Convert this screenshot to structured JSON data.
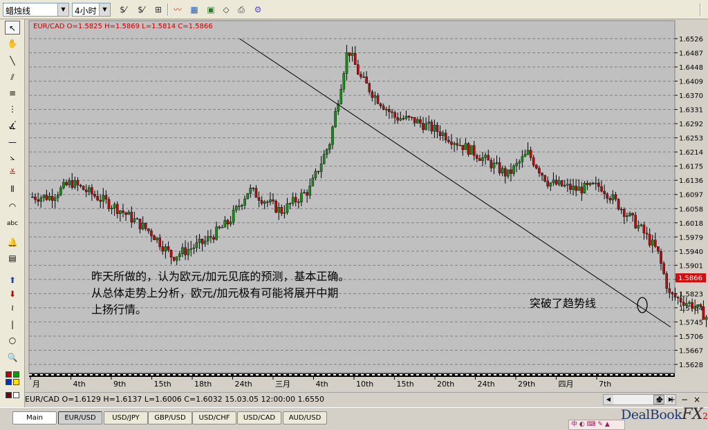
{
  "toolbar": {
    "chart_type": "蜡烛线",
    "timeframe": "4小时"
  },
  "chart_header": "EUR/CAD O=1.5825 H=1.5869 L=1.5814 C=1.5866",
  "chart_data": {
    "type": "candlestick",
    "symbol": "EUR/CAD",
    "y_ticks": [
      "1.6526",
      "1.6487",
      "1.6448",
      "1.6409",
      "1.6370",
      "1.6331",
      "1.6292",
      "1.6253",
      "1.6214",
      "1.6175",
      "1.6136",
      "1.6097",
      "1.6058",
      "1.6018",
      "1.5979",
      "1.5940",
      "1.5901",
      "1.5862",
      "1.5823",
      "1.5784",
      "1.5745",
      "1.5706",
      "1.5667",
      "1.5628"
    ],
    "ylim": [
      1.5628,
      1.6526
    ],
    "x_ticks": [
      "月",
      "4th",
      "9th",
      "15th",
      "18th",
      "24th",
      "三月",
      "4th",
      "10th",
      "15th",
      "20th",
      "24th",
      "29th",
      "四月",
      "7th"
    ],
    "last_price": "1.5866",
    "annotations": [
      "昨天所做的，认为欧元/加元见底的预测，基本正确。",
      "从总体走势上分析，欧元/加元极有可能将展开中期",
      "上扬行情。",
      "突破了趋势线"
    ],
    "trendline": {
      "start": {
        "x": "24th",
        "y": 1.6526
      },
      "end": {
        "x": "7th",
        "y": 1.575
      }
    },
    "anchors": [
      {
        "x": 0.5,
        "y": 1.609
      },
      {
        "x": 1,
        "y": 1.613
      },
      {
        "x": 2.2,
        "y": 1.6055
      },
      {
        "x": 3,
        "y": 1.599
      },
      {
        "x": 3.5,
        "y": 1.5925
      },
      {
        "x": 4.3,
        "y": 1.5965
      },
      {
        "x": 4.9,
        "y": 1.602
      },
      {
        "x": 5.4,
        "y": 1.611
      },
      {
        "x": 6.2,
        "y": 1.605
      },
      {
        "x": 6.9,
        "y": 1.611
      },
      {
        "x": 7.4,
        "y": 1.624
      },
      {
        "x": 7.85,
        "y": 1.65
      },
      {
        "x": 8.15,
        "y": 1.642
      },
      {
        "x": 8.5,
        "y": 1.637
      },
      {
        "x": 9,
        "y": 1.631
      },
      {
        "x": 9.5,
        "y": 1.63
      },
      {
        "x": 10.1,
        "y": 1.627
      },
      {
        "x": 11,
        "y": 1.621
      },
      {
        "x": 11.8,
        "y": 1.615
      },
      {
        "x": 12.3,
        "y": 1.621
      },
      {
        "x": 12.8,
        "y": 1.613
      },
      {
        "x": 13.5,
        "y": 1.611
      },
      {
        "x": 14.1,
        "y": 1.612
      },
      {
        "x": 14.6,
        "y": 1.606
      },
      {
        "x": 15.1,
        "y": 1.6
      },
      {
        "x": 15.5,
        "y": 1.594
      },
      {
        "x": 15.8,
        "y": 1.582
      },
      {
        "x": 16.4,
        "y": 1.579
      },
      {
        "x": 17,
        "y": 1.573
      },
      {
        "x": 17.5,
        "y": 1.576
      },
      {
        "x": 18.1,
        "y": 1.569
      },
      {
        "x": 18.5,
        "y": 1.565
      },
      {
        "x": 19,
        "y": 1.571
      },
      {
        "x": 19.5,
        "y": 1.569
      },
      {
        "x": 20.2,
        "y": 1.568
      },
      {
        "x": 20.9,
        "y": 1.57
      },
      {
        "x": 21.5,
        "y": 1.574
      },
      {
        "x": 22,
        "y": 1.5715
      },
      {
        "x": 22.4,
        "y": 1.586
      }
    ]
  },
  "infobar": {
    "text": "EUR/CAD O=1.6129 H=1.6137 L=1.6006 C=1.6032   15.03.05 12:00:00 1.6550"
  },
  "tabs": [
    "Main",
    "EUR/USD",
    "USD/JPY",
    "GBP/USD",
    "USD/CHF",
    "USD/CAD",
    "AUD/USD"
  ],
  "brand": {
    "name": "DealBook",
    "fx": "FX",
    "version": "2"
  },
  "tray_text": "中 ◐ ⌨ ✎ ▲"
}
